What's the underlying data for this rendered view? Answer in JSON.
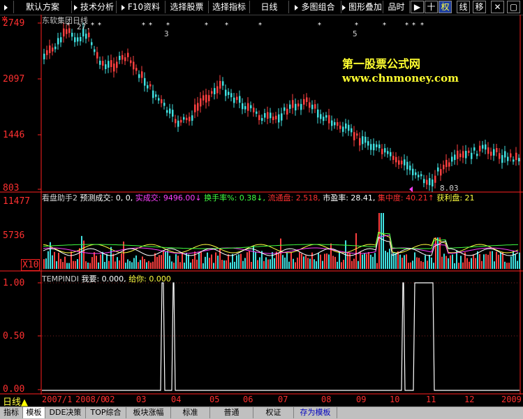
{
  "toolbar": {
    "buttons": [
      "默认方案",
      "技术分析",
      "F10资料",
      "选择股票",
      "选择指标",
      "日线",
      "多图组合",
      "图形叠加",
      "品时"
    ],
    "icons": [
      {
        "name": "right-arrow-icon",
        "glyph": "▶"
      },
      {
        "name": "crosshair-icon",
        "glyph": "十"
      },
      {
        "name": "quan",
        "glyph": "权"
      },
      {
        "name": "xian",
        "glyph": "线"
      },
      {
        "name": "yi",
        "glyph": "移"
      },
      {
        "name": "close-icon",
        "glyph": "✕"
      },
      {
        "name": "restore-icon",
        "glyph": "▢"
      }
    ]
  },
  "price_panel": {
    "title": "东软集团日线",
    "y_labels": [
      "2749",
      "2097",
      "1446",
      "803"
    ],
    "high_label": "27.",
    "low_label": "8.03",
    "event_counts": [
      "3",
      "5"
    ],
    "watermark_title": "第一股票公式网",
    "watermark_url": "www.chnmoney.com"
  },
  "volume_panel": {
    "y_labels": [
      "11477",
      "5736",
      "X10"
    ],
    "indicator": [
      {
        "text": "看盘助手2",
        "color": "#d0d0d0"
      },
      {
        "text": "预测成交: 0, 0,",
        "color": "#ffffff"
      },
      {
        "text": "实成交: 9496.00↓",
        "color": "#ff40ff"
      },
      {
        "text": "换手率%: 0.38↓,",
        "color": "#40ff40"
      },
      {
        "text": "流通盘: 2.518,",
        "color": "#ff3030"
      },
      {
        "text": "市盈率: 28.41,",
        "color": "#ffffff"
      },
      {
        "text": "集中度: 40.21↑",
        "color": "#ff3030"
      },
      {
        "text": "获利盘: 21",
        "color": "#ffff40"
      }
    ]
  },
  "signal_panel": {
    "name": "TEMPINDI",
    "my_label": "我要: 0.000,",
    "give_label": "给你: 0.000",
    "y_labels": [
      "1.00",
      "0.50",
      "0.00"
    ]
  },
  "date_axis": {
    "period": "日线",
    "labels": [
      "2007/1",
      "2008/0",
      "02",
      "03",
      "04",
      "05",
      "06",
      "07",
      "08",
      "09",
      "10",
      "11",
      "12",
      "2009"
    ]
  },
  "bottom_tabs": [
    "指标",
    "模板",
    "DDE决策",
    "TOP综合",
    "板块涨幅",
    "标准",
    "普通",
    "权证",
    "存为模板"
  ],
  "colors": {
    "up": "#ff4040",
    "down": "#40e0e0",
    "axis": "#ff2020",
    "signal": "#ffffff"
  }
}
